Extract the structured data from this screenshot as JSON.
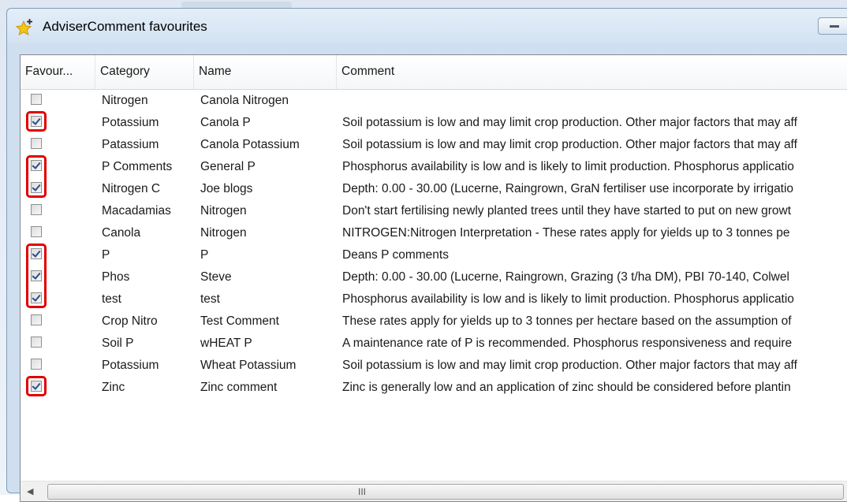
{
  "window": {
    "title": "AdviserComment favourites"
  },
  "columns": [
    "Favour...",
    "Category",
    "Name",
    "Comment"
  ],
  "rows": [
    {
      "fav": false,
      "category": "Nitrogen",
      "name": "Canola Nitrogen",
      "comment": ""
    },
    {
      "fav": true,
      "category": "Potassium",
      "name": "Canola P",
      "comment": "Soil potassium is low and may limit crop production. Other major factors that may aff"
    },
    {
      "fav": false,
      "category": "Patassium",
      "name": "Canola Potassium",
      "comment": "Soil potassium is low and may limit crop production. Other major factors that may aff"
    },
    {
      "fav": true,
      "category": "P Comments",
      "name": "General P",
      "comment": "Phosphorus availability is low and is likely to limit production. Phosphorus applicatio"
    },
    {
      "fav": true,
      "category": "Nitrogen C",
      "name": "Joe blogs",
      "comment": "Depth: 0.00 - 30.00 (Lucerne, Raingrown, GraN fertiliser use incorporate by irrigatio"
    },
    {
      "fav": false,
      "category": "Macadamias",
      "name": "Nitrogen",
      "comment": "Don't start fertilising newly planted trees until they have started to put on new growt"
    },
    {
      "fav": false,
      "category": "Canola",
      "name": "Nitrogen",
      "comment": "NITROGEN:Nitrogen Interpretation - These rates apply for yields up to 3 tonnes pe"
    },
    {
      "fav": true,
      "category": "P",
      "name": "P",
      "comment": "Deans P comments"
    },
    {
      "fav": true,
      "category": "Phos",
      "name": "Steve",
      "comment": "Depth: 0.00 - 30.00 (Lucerne, Raingrown, Grazing (3 t/ha DM), PBI 70-140, Colwel"
    },
    {
      "fav": true,
      "category": "test",
      "name": "test",
      "comment": "Phosphorus availability is low and is likely to limit production. Phosphorus applicatio"
    },
    {
      "fav": false,
      "category": "Crop Nitro",
      "name": "Test Comment",
      "comment": "These rates apply for yields up to 3 tonnes per hectare based on the assumption of"
    },
    {
      "fav": false,
      "category": "Soil P",
      "name": "wHEAT P",
      "comment": "A maintenance rate of P is recommended. Phosphorus responsiveness and require"
    },
    {
      "fav": false,
      "category": "Potassium",
      "name": "Wheat Potassium",
      "comment": "Soil potassium is low and may limit crop production. Other major factors that may aff"
    },
    {
      "fav": true,
      "category": "Zinc",
      "name": "Zinc comment",
      "comment": "Zinc is generally low and an application of zinc should be considered before plantin"
    }
  ],
  "scrollbar": {
    "grip": "III"
  },
  "colors": {
    "highlight": "#e00000",
    "accent": "#2a4d8a"
  }
}
